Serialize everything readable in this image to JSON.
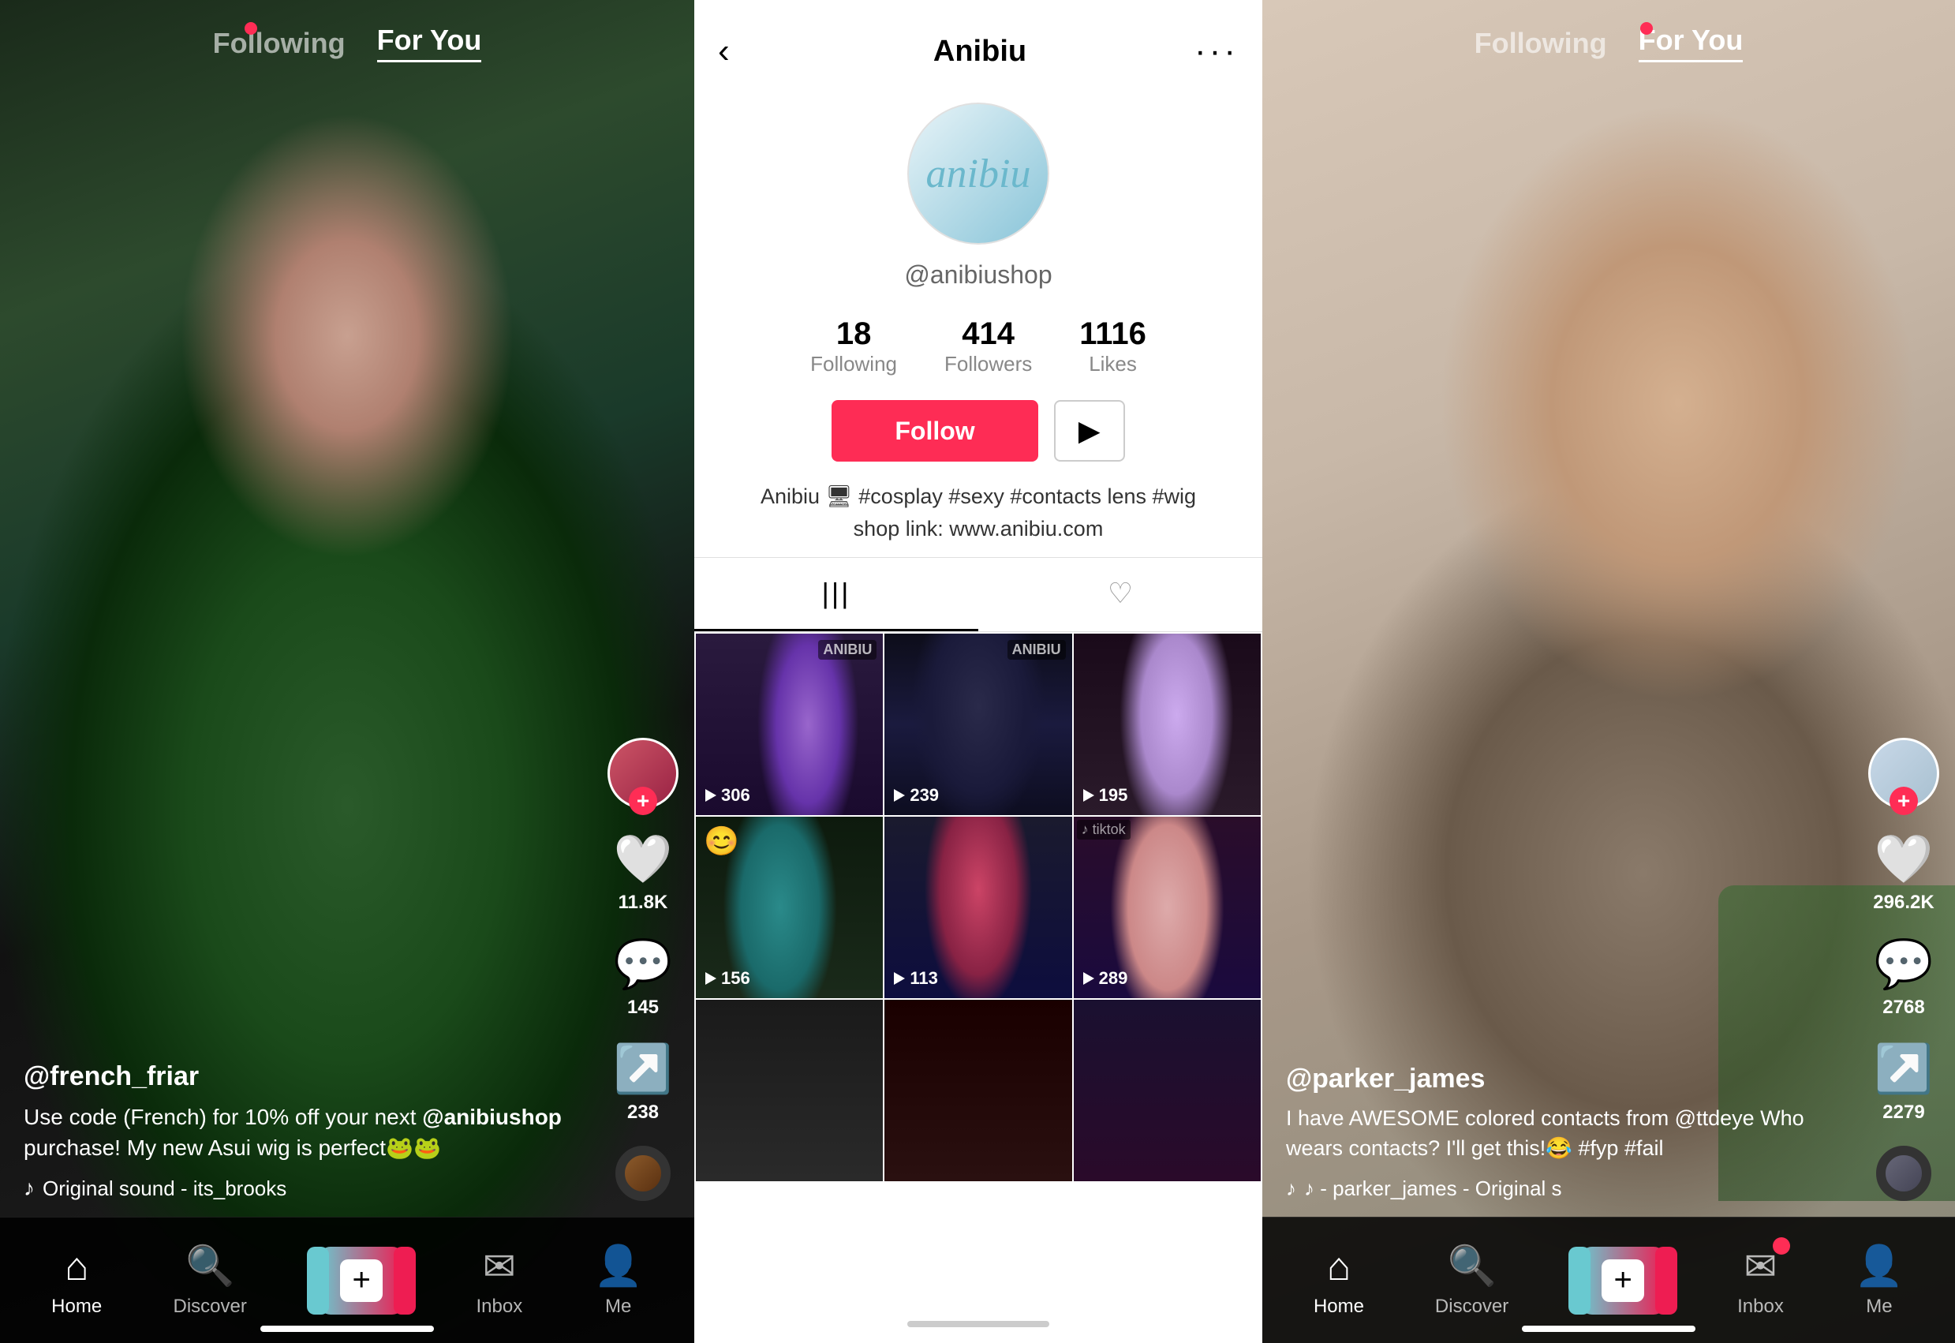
{
  "left": {
    "nav": {
      "following": "Following",
      "for_you": "For You"
    },
    "post": {
      "username": "@french_friar",
      "caption_line1": "Use code (French) for 10% off your next",
      "caption_tag": "@anibiushop",
      "caption_line2": " purchase! My new Asui wig is perfect🐸🐸",
      "sound": "Original sound - its_brooks",
      "likes": "11.8K",
      "comments": "145",
      "shares": "238"
    },
    "nav_items": {
      "home": "Home",
      "discover": "Discover",
      "inbox": "Inbox",
      "me": "Me"
    }
  },
  "center": {
    "header": {
      "title": "Anibiu",
      "back_label": "‹",
      "more_label": "···"
    },
    "profile": {
      "logo_text": "anibiu",
      "username": "@anibiushop",
      "following_count": "18",
      "following_label": "Following",
      "followers_count": "414",
      "followers_label": "Followers",
      "likes_count": "1116",
      "likes_label": "Likes"
    },
    "buttons": {
      "follow": "Follow",
      "youtube_icon": "▶"
    },
    "bio": {
      "line1": "Anibiu 🖥 #cosplay #sexy #contacts lens #wig",
      "line2": "shop link: www.anibiu.com"
    },
    "tabs": {
      "videos": "|||",
      "liked": "♡"
    },
    "videos": [
      {
        "id": 1,
        "views": "306",
        "has_watermark": true
      },
      {
        "id": 2,
        "views": "239",
        "has_watermark": true
      },
      {
        "id": 3,
        "views": "195",
        "has_watermark": false
      },
      {
        "id": 4,
        "views": "156",
        "has_watermark": false
      },
      {
        "id": 5,
        "views": "113",
        "has_watermark": false
      },
      {
        "id": 6,
        "views": "289",
        "has_watermark": false
      },
      {
        "id": 7,
        "views": "",
        "has_watermark": false
      },
      {
        "id": 8,
        "views": "",
        "has_watermark": false
      },
      {
        "id": 9,
        "views": "",
        "has_watermark": false
      }
    ]
  },
  "right": {
    "nav": {
      "following": "Following",
      "for_you": "For You"
    },
    "post": {
      "username": "@parker_james",
      "caption": "I have AWESOME colored contacts from @ttdeye Who wears contacts? I'll get this!😂 #fyp #fail",
      "sound": "♪  - parker_james - Original s",
      "likes": "296.2K",
      "comments": "2768",
      "shares": "2279"
    },
    "nav_items": {
      "home": "Home",
      "discover": "Discover",
      "inbox": "Inbox",
      "me": "Me"
    }
  }
}
